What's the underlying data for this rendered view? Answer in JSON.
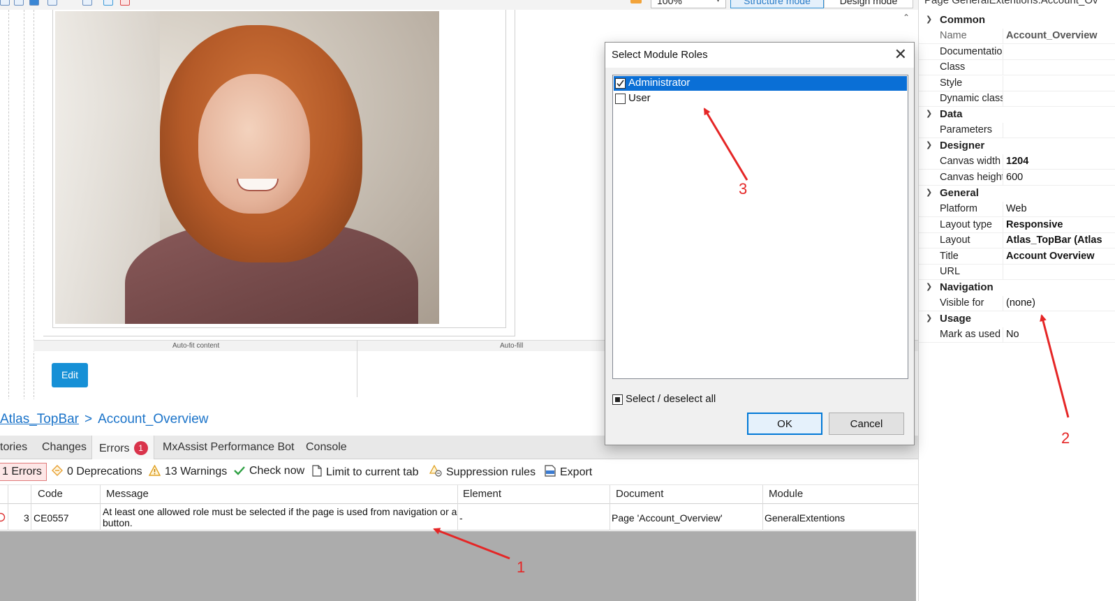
{
  "toolbar": {
    "zoom": "100%",
    "structure_mode": "Structure mode",
    "design_mode": "Design mode"
  },
  "canvas": {
    "autofit_label": "Auto-fit content",
    "autofill_label": "Auto-fill",
    "edit_label": "Edit"
  },
  "breadcrumb": {
    "layout": "Atlas_TopBar",
    "separator": ">",
    "page": "Account_Overview"
  },
  "bottom_tabs": {
    "stories": "tories",
    "changes": "Changes",
    "errors": "Errors",
    "errors_count": "1",
    "mxassist": "MxAssist Performance Bot",
    "console": "Console"
  },
  "filters": {
    "errors": "1 Errors",
    "deprecations": "0 Deprecations",
    "warnings": "13 Warnings",
    "check_now": "Check now",
    "limit": "Limit to current tab",
    "suppression": "Suppression rules",
    "export": "Export"
  },
  "error_grid": {
    "columns": [
      "Code",
      "Message",
      "Element",
      "Document",
      "Module"
    ],
    "rows": [
      {
        "index": "3",
        "code": "CE0557",
        "message": "At least one allowed role must be selected if the page is used from navigation or a button.",
        "element": "-",
        "document": "Page 'Account_Overview'",
        "module": "GeneralExtentions"
      }
    ]
  },
  "properties": {
    "header": "Page  GeneralExtentions.Account_Ov",
    "categories": {
      "common": "Common",
      "data": "Data",
      "designer": "Designer",
      "general": "General",
      "navigation": "Navigation",
      "usage": "Usage"
    },
    "rows": {
      "name": {
        "label": "Name",
        "value": "Account_Overview"
      },
      "documentation": {
        "label": "Documentation",
        "value": ""
      },
      "class": {
        "label": "Class",
        "value": ""
      },
      "style": {
        "label": "Style",
        "value": ""
      },
      "dynamic_class": {
        "label": "Dynamic class",
        "value": ""
      },
      "parameters": {
        "label": "Parameters",
        "value": ""
      },
      "canvas_width": {
        "label": "Canvas width",
        "value": "1204"
      },
      "canvas_height": {
        "label": "Canvas height",
        "value": "600"
      },
      "platform": {
        "label": "Platform",
        "value": "Web"
      },
      "layout_type": {
        "label": "Layout type",
        "value": "Responsive"
      },
      "layout": {
        "label": "Layout",
        "value": "Atlas_TopBar (Atlas"
      },
      "title": {
        "label": "Title",
        "value": "Account Overview"
      },
      "url": {
        "label": "URL",
        "value": ""
      },
      "visible_for": {
        "label": "Visible for",
        "value": "(none)"
      },
      "mark_as_used": {
        "label": "Mark as used",
        "value": "No"
      }
    }
  },
  "dialog": {
    "title": "Select Module Roles",
    "close": "✕",
    "roles": [
      {
        "label": "Administrator",
        "checked": true,
        "selected": true
      },
      {
        "label": "User",
        "checked": false,
        "selected": false
      }
    ],
    "select_all": "Select / deselect all",
    "ok": "OK",
    "cancel": "Cancel"
  },
  "annotations": {
    "n1": "1",
    "n2": "2",
    "n3": "3"
  },
  "colors": {
    "accent": "#1690d6",
    "selection": "#0a6fd6",
    "error_badge": "#d9334b",
    "annotation": "#e52626"
  }
}
